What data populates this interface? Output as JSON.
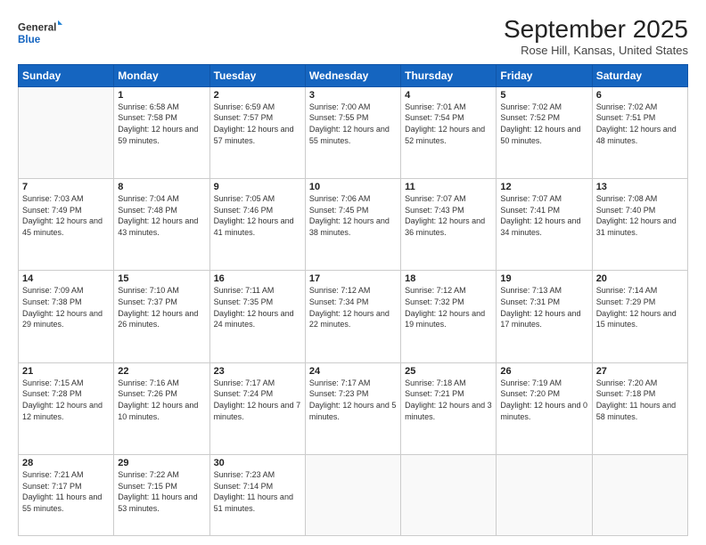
{
  "logo": {
    "line1": "General",
    "line2": "Blue"
  },
  "title": "September 2025",
  "subtitle": "Rose Hill, Kansas, United States",
  "weekdays": [
    "Sunday",
    "Monday",
    "Tuesday",
    "Wednesday",
    "Thursday",
    "Friday",
    "Saturday"
  ],
  "weeks": [
    [
      {
        "day": "",
        "sunrise": "",
        "sunset": "",
        "daylight": ""
      },
      {
        "day": "1",
        "sunrise": "Sunrise: 6:58 AM",
        "sunset": "Sunset: 7:58 PM",
        "daylight": "Daylight: 12 hours and 59 minutes."
      },
      {
        "day": "2",
        "sunrise": "Sunrise: 6:59 AM",
        "sunset": "Sunset: 7:57 PM",
        "daylight": "Daylight: 12 hours and 57 minutes."
      },
      {
        "day": "3",
        "sunrise": "Sunrise: 7:00 AM",
        "sunset": "Sunset: 7:55 PM",
        "daylight": "Daylight: 12 hours and 55 minutes."
      },
      {
        "day": "4",
        "sunrise": "Sunrise: 7:01 AM",
        "sunset": "Sunset: 7:54 PM",
        "daylight": "Daylight: 12 hours and 52 minutes."
      },
      {
        "day": "5",
        "sunrise": "Sunrise: 7:02 AM",
        "sunset": "Sunset: 7:52 PM",
        "daylight": "Daylight: 12 hours and 50 minutes."
      },
      {
        "day": "6",
        "sunrise": "Sunrise: 7:02 AM",
        "sunset": "Sunset: 7:51 PM",
        "daylight": "Daylight: 12 hours and 48 minutes."
      }
    ],
    [
      {
        "day": "7",
        "sunrise": "Sunrise: 7:03 AM",
        "sunset": "Sunset: 7:49 PM",
        "daylight": "Daylight: 12 hours and 45 minutes."
      },
      {
        "day": "8",
        "sunrise": "Sunrise: 7:04 AM",
        "sunset": "Sunset: 7:48 PM",
        "daylight": "Daylight: 12 hours and 43 minutes."
      },
      {
        "day": "9",
        "sunrise": "Sunrise: 7:05 AM",
        "sunset": "Sunset: 7:46 PM",
        "daylight": "Daylight: 12 hours and 41 minutes."
      },
      {
        "day": "10",
        "sunrise": "Sunrise: 7:06 AM",
        "sunset": "Sunset: 7:45 PM",
        "daylight": "Daylight: 12 hours and 38 minutes."
      },
      {
        "day": "11",
        "sunrise": "Sunrise: 7:07 AM",
        "sunset": "Sunset: 7:43 PM",
        "daylight": "Daylight: 12 hours and 36 minutes."
      },
      {
        "day": "12",
        "sunrise": "Sunrise: 7:07 AM",
        "sunset": "Sunset: 7:41 PM",
        "daylight": "Daylight: 12 hours and 34 minutes."
      },
      {
        "day": "13",
        "sunrise": "Sunrise: 7:08 AM",
        "sunset": "Sunset: 7:40 PM",
        "daylight": "Daylight: 12 hours and 31 minutes."
      }
    ],
    [
      {
        "day": "14",
        "sunrise": "Sunrise: 7:09 AM",
        "sunset": "Sunset: 7:38 PM",
        "daylight": "Daylight: 12 hours and 29 minutes."
      },
      {
        "day": "15",
        "sunrise": "Sunrise: 7:10 AM",
        "sunset": "Sunset: 7:37 PM",
        "daylight": "Daylight: 12 hours and 26 minutes."
      },
      {
        "day": "16",
        "sunrise": "Sunrise: 7:11 AM",
        "sunset": "Sunset: 7:35 PM",
        "daylight": "Daylight: 12 hours and 24 minutes."
      },
      {
        "day": "17",
        "sunrise": "Sunrise: 7:12 AM",
        "sunset": "Sunset: 7:34 PM",
        "daylight": "Daylight: 12 hours and 22 minutes."
      },
      {
        "day": "18",
        "sunrise": "Sunrise: 7:12 AM",
        "sunset": "Sunset: 7:32 PM",
        "daylight": "Daylight: 12 hours and 19 minutes."
      },
      {
        "day": "19",
        "sunrise": "Sunrise: 7:13 AM",
        "sunset": "Sunset: 7:31 PM",
        "daylight": "Daylight: 12 hours and 17 minutes."
      },
      {
        "day": "20",
        "sunrise": "Sunrise: 7:14 AM",
        "sunset": "Sunset: 7:29 PM",
        "daylight": "Daylight: 12 hours and 15 minutes."
      }
    ],
    [
      {
        "day": "21",
        "sunrise": "Sunrise: 7:15 AM",
        "sunset": "Sunset: 7:28 PM",
        "daylight": "Daylight: 12 hours and 12 minutes."
      },
      {
        "day": "22",
        "sunrise": "Sunrise: 7:16 AM",
        "sunset": "Sunset: 7:26 PM",
        "daylight": "Daylight: 12 hours and 10 minutes."
      },
      {
        "day": "23",
        "sunrise": "Sunrise: 7:17 AM",
        "sunset": "Sunset: 7:24 PM",
        "daylight": "Daylight: 12 hours and 7 minutes."
      },
      {
        "day": "24",
        "sunrise": "Sunrise: 7:17 AM",
        "sunset": "Sunset: 7:23 PM",
        "daylight": "Daylight: 12 hours and 5 minutes."
      },
      {
        "day": "25",
        "sunrise": "Sunrise: 7:18 AM",
        "sunset": "Sunset: 7:21 PM",
        "daylight": "Daylight: 12 hours and 3 minutes."
      },
      {
        "day": "26",
        "sunrise": "Sunrise: 7:19 AM",
        "sunset": "Sunset: 7:20 PM",
        "daylight": "Daylight: 12 hours and 0 minutes."
      },
      {
        "day": "27",
        "sunrise": "Sunrise: 7:20 AM",
        "sunset": "Sunset: 7:18 PM",
        "daylight": "Daylight: 11 hours and 58 minutes."
      }
    ],
    [
      {
        "day": "28",
        "sunrise": "Sunrise: 7:21 AM",
        "sunset": "Sunset: 7:17 PM",
        "daylight": "Daylight: 11 hours and 55 minutes."
      },
      {
        "day": "29",
        "sunrise": "Sunrise: 7:22 AM",
        "sunset": "Sunset: 7:15 PM",
        "daylight": "Daylight: 11 hours and 53 minutes."
      },
      {
        "day": "30",
        "sunrise": "Sunrise: 7:23 AM",
        "sunset": "Sunset: 7:14 PM",
        "daylight": "Daylight: 11 hours and 51 minutes."
      },
      {
        "day": "",
        "sunrise": "",
        "sunset": "",
        "daylight": ""
      },
      {
        "day": "",
        "sunrise": "",
        "sunset": "",
        "daylight": ""
      },
      {
        "day": "",
        "sunrise": "",
        "sunset": "",
        "daylight": ""
      },
      {
        "day": "",
        "sunrise": "",
        "sunset": "",
        "daylight": ""
      }
    ]
  ]
}
